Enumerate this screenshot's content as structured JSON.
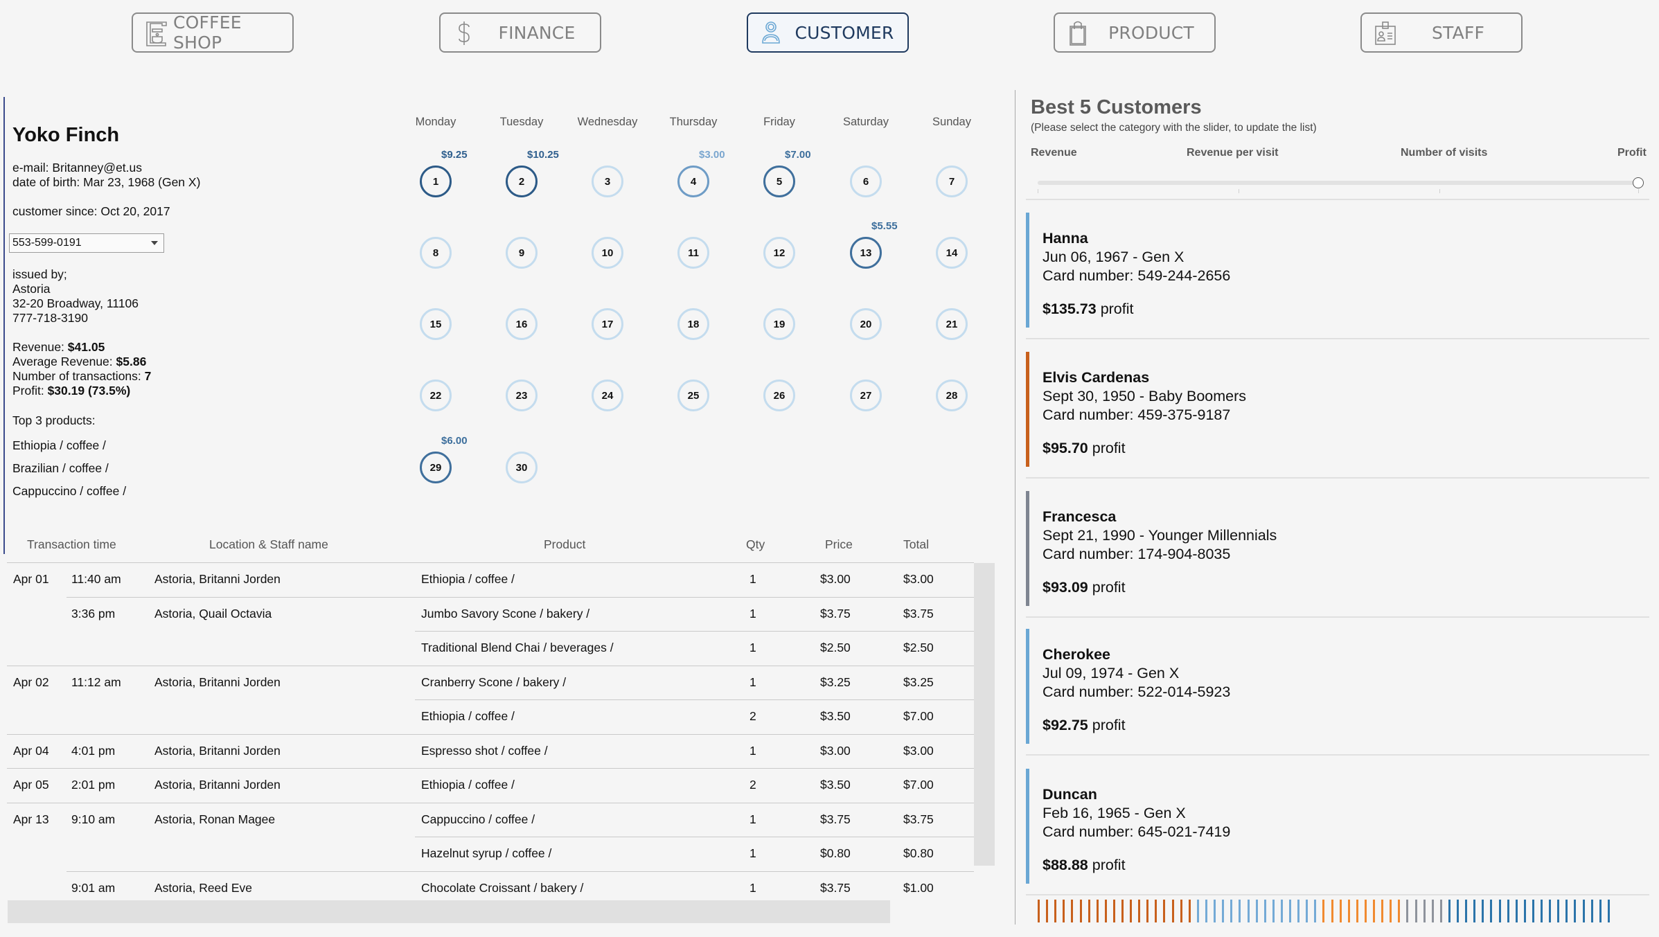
{
  "nav": [
    {
      "label": "COFFEE SHOP",
      "icon": "coffee-machine-icon",
      "active": false
    },
    {
      "label": "FINANCE",
      "icon": "dollar-icon",
      "active": false
    },
    {
      "label": "CUSTOMER",
      "icon": "person-icon",
      "active": true
    },
    {
      "label": "PRODUCT",
      "icon": "shopping-bag-icon",
      "active": false
    },
    {
      "label": "STAFF",
      "icon": "id-badge-icon",
      "active": false
    }
  ],
  "customer": {
    "name": "Yoko Finch",
    "email": "e-mail: Britanney@et.us",
    "dob": "date of birth: Mar 23, 1968 (Gen X)",
    "since": "customer since: Oct 20, 2017",
    "card_selected": "553-599-0191",
    "issued_label": "issued by;",
    "issued_store": "Astoria",
    "issued_address": "32-20 Broadway, 11106",
    "issued_phone": "777-718-3190",
    "stats": [
      {
        "label": "Revenue: ",
        "value": "$41.05"
      },
      {
        "label": "Average Revenue: ",
        "value": "$5.86"
      },
      {
        "label": "Number of transactions: ",
        "value": "7"
      },
      {
        "label": "Profit: ",
        "value": "$30.19 (73.5%)"
      }
    ],
    "top_products_label": "Top 3 products:",
    "top_products": [
      "Ethiopia / coffee /",
      "Brazilian / coffee /",
      "Cappuccino / coffee /"
    ]
  },
  "calendar": {
    "weekdays": [
      "Monday",
      "Tuesday",
      "Wednesday",
      "Thursday",
      "Friday",
      "Saturday",
      "Sunday"
    ],
    "first_weekday_index": 0,
    "days_in_month": 30,
    "amounts": {
      "1": "$9.25",
      "2": "$10.25",
      "4": "$3.00",
      "5": "$7.00",
      "13": "$5.55",
      "29": "$6.00"
    },
    "amount_level": {
      "1": 1,
      "2": 1,
      "4": 3,
      "5": 2,
      "13": 2,
      "29": 2
    },
    "colors": {
      "empty": "#c4dcee",
      "level1": "#2c5a87",
      "level2": "#3f6f9c",
      "level3": "#6e9cc6",
      "amount1": "#2f5f8e",
      "amount2": "#3c6e9c",
      "amount3": "#7aa6cf"
    }
  },
  "transactions": {
    "headers": {
      "time": "Transaction time",
      "location": "Location & Staff name",
      "product": "Product",
      "qty": "Qty",
      "price": "Price",
      "total": "Total"
    },
    "rows": [
      {
        "date": "Apr 01",
        "time": "11:40 am",
        "location": "Astoria, Britanni Jorden",
        "product": "Ethiopia / coffee /",
        "qty": "1",
        "price": "$3.00",
        "total": "$3.00",
        "sep": "full"
      },
      {
        "date": "",
        "time": "3:36 pm",
        "location": "Astoria, Quail Octavia",
        "product": "Jumbo Savory Scone / bakery /",
        "qty": "1",
        "price": "$3.75",
        "total": "$3.75",
        "sep": "time"
      },
      {
        "date": "",
        "time": "",
        "location": "",
        "product": "Traditional Blend Chai / beverages /",
        "qty": "1",
        "price": "$2.50",
        "total": "$2.50",
        "sep": "product"
      },
      {
        "date": "Apr 02",
        "time": "11:12 am",
        "location": "Astoria, Britanni Jorden",
        "product": "Cranberry Scone / bakery /",
        "qty": "1",
        "price": "$3.25",
        "total": "$3.25",
        "sep": "full"
      },
      {
        "date": "",
        "time": "",
        "location": "",
        "product": "Ethiopia / coffee /",
        "qty": "2",
        "price": "$3.50",
        "total": "$7.00",
        "sep": "product"
      },
      {
        "date": "Apr 04",
        "time": "4:01 pm",
        "location": "Astoria, Britanni Jorden",
        "product": "Espresso shot / coffee /",
        "qty": "1",
        "price": "$3.00",
        "total": "$3.00",
        "sep": "full"
      },
      {
        "date": "Apr 05",
        "time": "2:01 pm",
        "location": "Astoria, Britanni Jorden",
        "product": "Ethiopia / coffee /",
        "qty": "2",
        "price": "$3.50",
        "total": "$7.00",
        "sep": "full"
      },
      {
        "date": "Apr 13",
        "time": "9:10 am",
        "location": "Astoria, Ronan Magee",
        "product": "Cappuccino / coffee /",
        "qty": "1",
        "price": "$3.75",
        "total": "$3.75",
        "sep": "full"
      },
      {
        "date": "",
        "time": "",
        "location": "",
        "product": "Hazelnut syrup / coffee /",
        "qty": "1",
        "price": "$0.80",
        "total": "$0.80",
        "sep": "product"
      },
      {
        "date": "",
        "time": "9:01 am",
        "location": "Astoria, Reed Eve",
        "product": "Chocolate Croissant / bakery /",
        "qty": "1",
        "price": "$3.75",
        "total": "$1.00",
        "sep": "time"
      }
    ]
  },
  "best_customers": {
    "title": "Best 5 Customers",
    "subtitle": "(Please select the category with the slider, to update the list)",
    "slider_options": [
      "Revenue",
      "Revenue per visit",
      "Number of visits",
      "Profit"
    ],
    "slider_selected": "Profit",
    "profit_suffix": " profit",
    "cards": [
      {
        "name": "Hanna",
        "dob": "Jun 06, 1967 - Gen X",
        "card": "Card number: 549-244-2656",
        "profit": "$135.73",
        "color": "#6aa7d4"
      },
      {
        "name": "Elvis Cardenas",
        "dob": "Sept 30, 1950 - Baby Boomers",
        "card": "Card number: 459-375-9187",
        "profit": "$95.70",
        "color": "#c8601c"
      },
      {
        "name": "Francesca",
        "dob": "Sept 21, 1990 - Younger Millennials",
        "card": "Card number: 174-904-8035",
        "profit": "$93.09",
        "color": "#7f8591"
      },
      {
        "name": "Cherokee",
        "dob": "Jul 09, 1974 - Gen X",
        "card": "Card number: 522-014-5923",
        "profit": "$92.75",
        "color": "#6aa7d4"
      },
      {
        "name": "Duncan",
        "dob": "Feb 16, 1965 - Gen X",
        "card": "Card number: 645-021-7419",
        "profit": "$88.88",
        "color": "#6aa7d4"
      }
    ],
    "generation_strip": [
      {
        "color": "#c8601c",
        "count": 19
      },
      {
        "color": "#74aad6",
        "count": 15
      },
      {
        "color": "#f08a30",
        "count": 10
      },
      {
        "color": "#8e939c",
        "count": 5
      },
      {
        "color": "#2b74aa",
        "count": 20
      }
    ]
  }
}
